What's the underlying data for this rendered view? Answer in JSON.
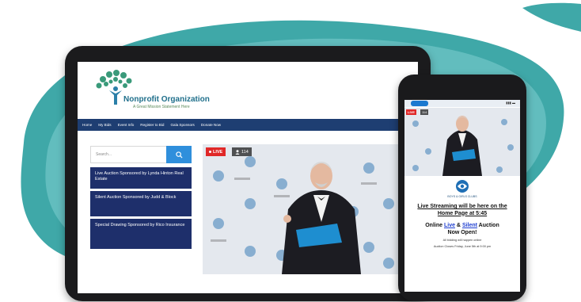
{
  "site": {
    "org_name": "Nonprofit Organization",
    "tagline": "A Great Mission Statement Here"
  },
  "nav": {
    "items": [
      "Home",
      "My Bids",
      "Event Info",
      "Register to Bid",
      "Gala Sponsors",
      "Donate Now"
    ]
  },
  "search": {
    "placeholder": "Search..."
  },
  "sidebar": {
    "items": [
      {
        "label": "Live Auction Sponsored by Lynda Hinton Real Estate"
      },
      {
        "label": "Silent Auction Sponsored by Judd & Block"
      },
      {
        "label": "Special Drawing Sponsored by Rico Insurance"
      }
    ]
  },
  "video": {
    "live_label": "LIVE",
    "viewer_count": "114"
  },
  "phone": {
    "status_right": "▮▮▮ ▬",
    "live_label": "LIVE",
    "viewer_count": "114",
    "club_name": "BOYS & GIRLS CLUBS",
    "stream_line1": "Live Streaming will be here on the",
    "stream_line2": "Home Page at 5:45",
    "auction_prefix": "Online ",
    "auction_live": "Live",
    "auction_amp": " & ",
    "auction_silent": "Silent",
    "auction_suffix": " Auction",
    "auction_line2": "Now Open!",
    "note1": "All bidding will happen online",
    "note2": "Auction Closes Friday, June 5th at 9:00 pm"
  },
  "colors": {
    "nav_bg": "#1e3e72",
    "sidebar_bg": "#1e2f6b",
    "search_btn": "#2f8fdc",
    "live_red": "#e02828",
    "teal_bg": "#3fa8a8"
  },
  "icons": {
    "search": "search-icon",
    "viewer": "person-icon",
    "logo": "tree-person-logo"
  }
}
